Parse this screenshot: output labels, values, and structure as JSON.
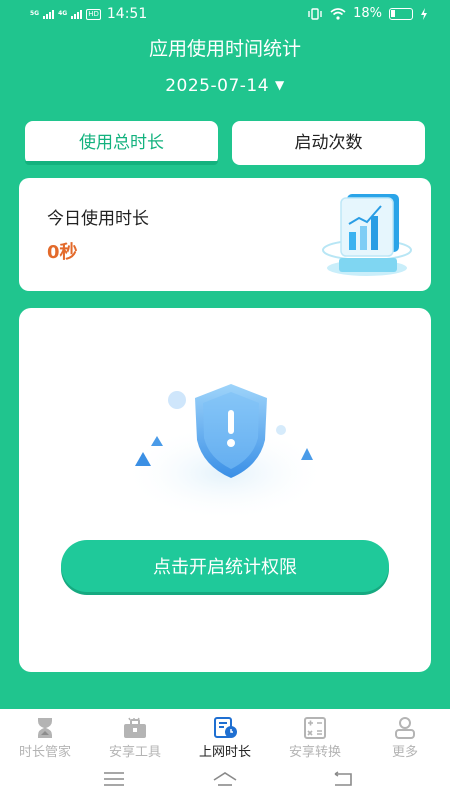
{
  "status_bar": {
    "net_1": "5G",
    "net_2": "4G",
    "hd": "HD",
    "time": "14:51",
    "battery_percent": "18%"
  },
  "header": {
    "title": "应用使用时间统计",
    "date": "2025-07-14"
  },
  "tabs": [
    {
      "label": "使用总时长",
      "active": true
    },
    {
      "label": "启动次数",
      "active": false
    }
  ],
  "today_card": {
    "label": "今日使用时长",
    "value": "0秒"
  },
  "permission_card": {
    "button_label": "点击开启统计权限"
  },
  "bottom_nav": [
    {
      "label": "时长管家",
      "icon": "hourglass-icon",
      "active": false
    },
    {
      "label": "安享工具",
      "icon": "toolbox-icon",
      "active": false
    },
    {
      "label": "上网时长",
      "icon": "document-clock-icon",
      "active": true
    },
    {
      "label": "安享转换",
      "icon": "calculator-icon",
      "active": false
    },
    {
      "label": "更多",
      "icon": "user-icon",
      "active": false
    }
  ],
  "colors": {
    "brand_green": "#20c58e",
    "button_green": "#1fc99a",
    "accent_text": "#13b27e",
    "value_orange": "#e36a2b"
  }
}
